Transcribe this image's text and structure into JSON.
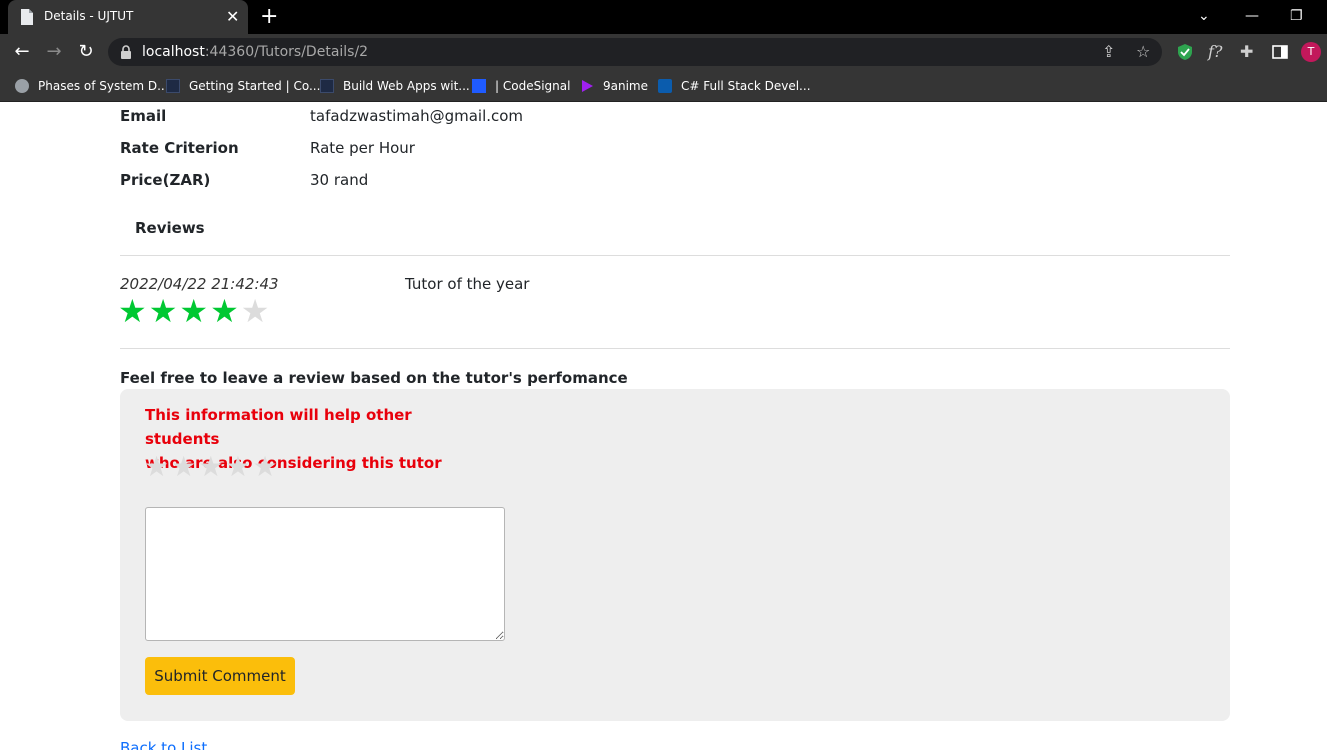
{
  "browser": {
    "tab_title": "Details - UJTUT",
    "url_host": "localhost",
    "url_path": ":44360/Tutors/Details/2",
    "profile_initial": "T",
    "bookmarks": [
      "Phases of System D...",
      "Getting Started | Co...",
      "Build Web Apps wit...",
      "| CodeSignal",
      "9anime",
      "C# Full Stack Devel..."
    ]
  },
  "details": {
    "email_label": "Email",
    "email_value": "tafadzwastimah@gmail.com",
    "rate_label": "Rate Criterion",
    "rate_value": "Rate per Hour",
    "price_label": "Price(ZAR)",
    "price_value": "30 rand"
  },
  "reviews": {
    "title": "Reviews",
    "items": [
      {
        "date": "2022/04/22 21:42:43",
        "rating": 4,
        "max_rating": 5,
        "comment": "Tutor of the year"
      }
    ]
  },
  "review_form": {
    "prompt": "Feel free to leave a review based on the tutor's perfomance",
    "info_line1": "This information will help other students",
    "info_line2": "who are also considering this tutor",
    "rating": 0,
    "max_rating": 5,
    "comment_value": "",
    "submit_label": "Submit Comment"
  },
  "back_link": "Back to List",
  "colors": {
    "star_filled": "#00c832",
    "star_empty": "#dcdcdc",
    "info_text": "#e8000b",
    "submit_button": "#fbbe0b",
    "link": "#0d6efd"
  }
}
